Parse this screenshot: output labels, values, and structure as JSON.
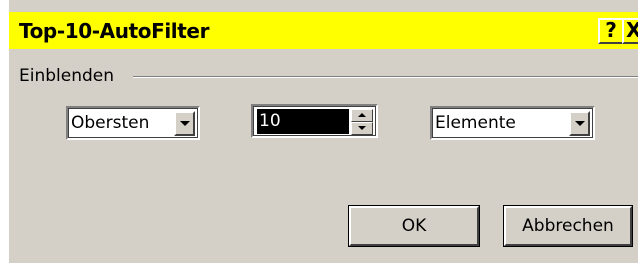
{
  "window": {
    "title": "Top-10-AutoFilter",
    "help_glyph": "?",
    "close_glyph": "X",
    "titlebar_color": "#ffff00",
    "face_color": "#d4d0c8"
  },
  "group": {
    "label": "Einblenden"
  },
  "controls": {
    "direction": {
      "value": "Obersten"
    },
    "count": {
      "value": "10"
    },
    "unit": {
      "value": "Elemente"
    }
  },
  "buttons": {
    "ok_label": "OK",
    "cancel_label": "Abbrechen"
  },
  "icons": {
    "dropdown": "chevron-down-icon",
    "spin_up": "arrow-up-icon",
    "spin_down": "arrow-down-icon"
  }
}
